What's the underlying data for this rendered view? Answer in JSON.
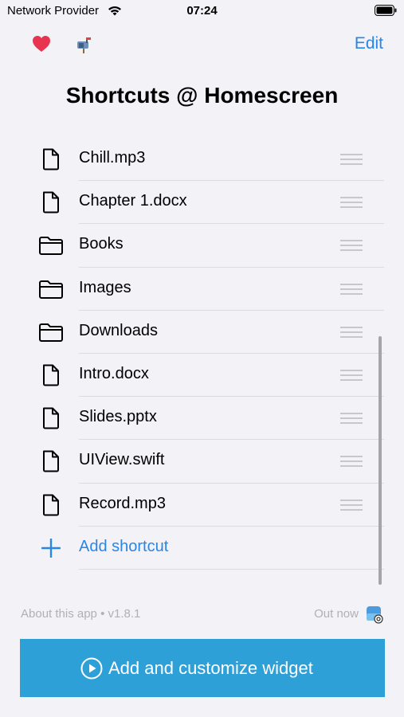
{
  "status_bar": {
    "carrier": "Network Provider",
    "time": "07:24"
  },
  "nav": {
    "edit_label": "Edit"
  },
  "title": "Shortcuts @ Homescreen",
  "shortcuts": [
    {
      "label": "Chill.mp3",
      "icon": "file-icon"
    },
    {
      "label": "Chapter 1.docx",
      "icon": "file-icon"
    },
    {
      "label": "Books",
      "icon": "folder-icon"
    },
    {
      "label": "Images",
      "icon": "folder-icon"
    },
    {
      "label": "Downloads",
      "icon": "folder-icon"
    },
    {
      "label": "Intro.docx",
      "icon": "file-icon"
    },
    {
      "label": "Slides.pptx",
      "icon": "file-icon"
    },
    {
      "label": "UIView.swift",
      "icon": "file-icon"
    },
    {
      "label": "Record.mp3",
      "icon": "file-icon"
    }
  ],
  "add_shortcut_label": "Add shortcut",
  "footer": {
    "about": "About this app • v1.8.1",
    "out_now": "Out now"
  },
  "widget_button_label": "Add and customize widget",
  "colors": {
    "accent": "#2a86e6",
    "button_bg": "#2ea0d8",
    "background": "#f2f2f7"
  }
}
